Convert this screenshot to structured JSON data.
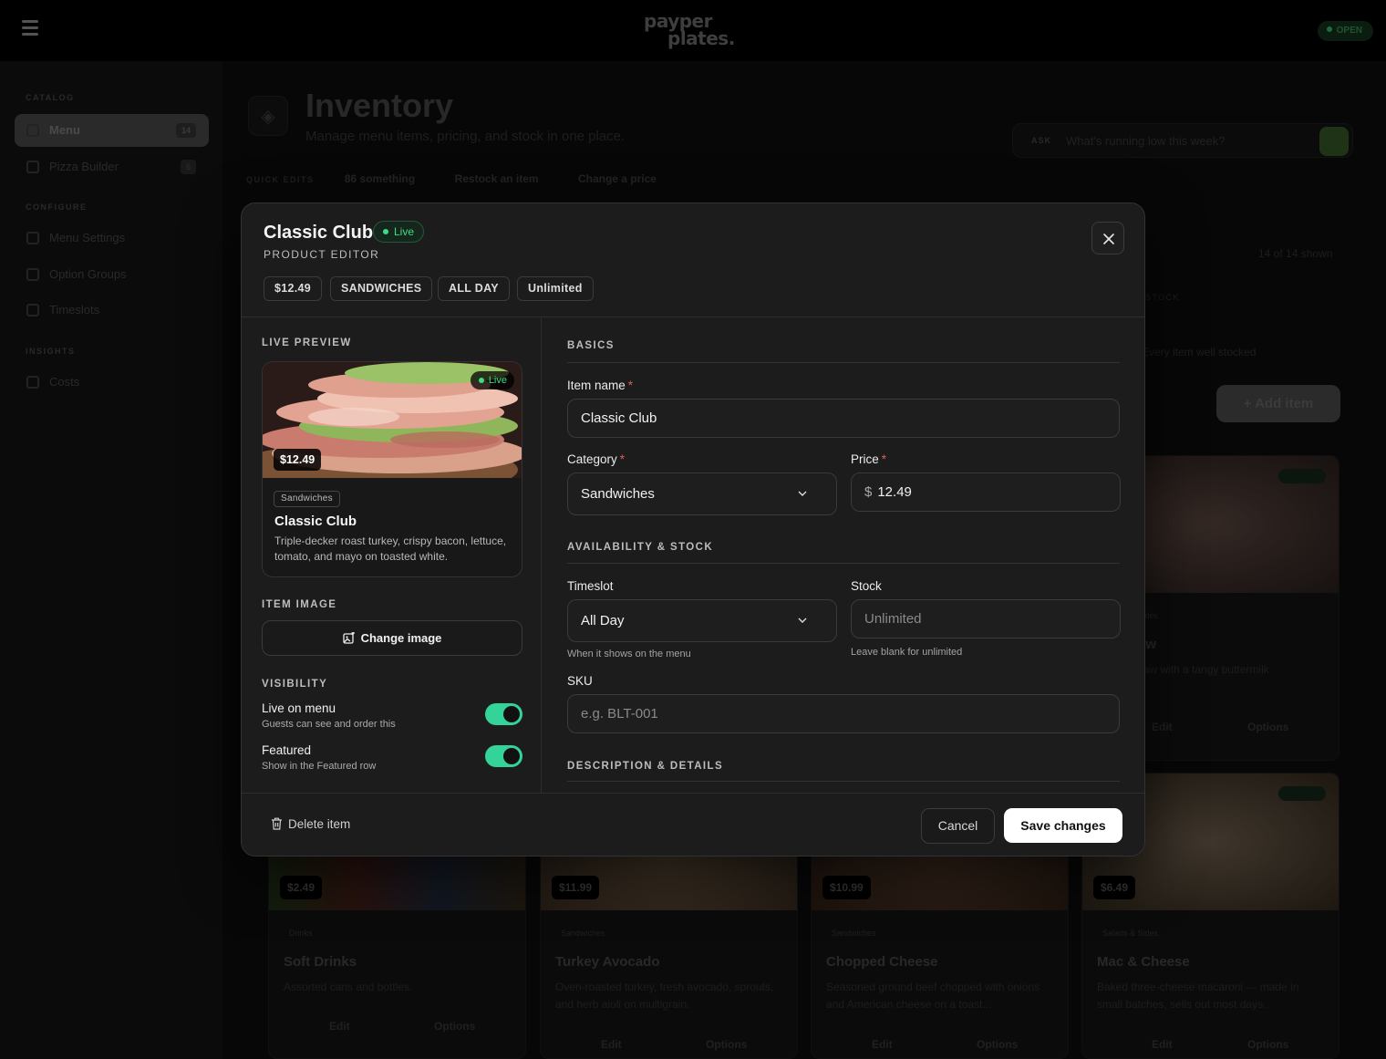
{
  "app": {
    "logo": [
      "payper",
      "plates."
    ],
    "status": "OPEN"
  },
  "sidebar": {
    "sections": [
      "CATALOG",
      "CONFIGURE",
      "INSIGHTS"
    ],
    "items": [
      {
        "label": "Menu",
        "count": "14",
        "active": true
      },
      {
        "label": "Pizza Builder",
        "count": "6"
      },
      {
        "label": "Menu Settings"
      },
      {
        "label": "Option Groups"
      },
      {
        "label": "Timeslots"
      },
      {
        "label": "Costs"
      }
    ]
  },
  "page": {
    "title": "Inventory",
    "subtitle": "Manage menu items, pricing, and stock in one place.",
    "ask_label": "ASK",
    "ask_placeholder": "What's running low this week?",
    "quick_edits_label": "QUICK EDITS",
    "quick_edits": [
      "86 something",
      "Restock an item",
      "Change a price"
    ],
    "shown_count": "14 of 14 shown",
    "stock_label": "STOCK",
    "stock_note": "Every item well stocked",
    "add_item_label": "+ Add item"
  },
  "cards": [
    {
      "price": "$2.49",
      "category": "Drinks",
      "name": "Soft Drinks",
      "desc": "Assorted cans and bottles.",
      "edit": "Edit",
      "options": "Options"
    },
    {
      "price": "$11.99",
      "category": "Sandwiches",
      "name": "Turkey Avocado",
      "desc": "Oven-roasted turkey, fresh avocado, sprouts, and herb aioli on multigrain.",
      "edit": "Edit",
      "options": "Options"
    },
    {
      "price": "$10.99",
      "category": "Sandwiches",
      "name": "Chopped Cheese",
      "desc": "Seasoned ground beef chopped with onions and American cheese on a toast...",
      "edit": "Edit",
      "options": "Options"
    },
    {
      "price": "$6.49",
      "category": "Salads & Sides",
      "name": "Mac & Cheese",
      "desc": "Baked three-cheese macaroni — made in small batches, sells out most days.",
      "edit": "Edit",
      "options": "Options"
    },
    {
      "category": "Salads & Sides",
      "name": "Coleslaw",
      "desc": "Classic slaw with a tangy buttermilk",
      "edit": "Edit",
      "options": "Options"
    }
  ],
  "modal": {
    "title": "Classic Club",
    "status_badge": "Live",
    "subtitle": "PRODUCT EDITOR",
    "chips": [
      "$12.49",
      "SANDWICHES",
      "ALL DAY",
      "Unlimited"
    ],
    "left": {
      "live_preview_label": "LIVE PREVIEW",
      "preview": {
        "badge": "Live",
        "price": "$12.49",
        "category": "Sandwiches",
        "name": "Classic Club",
        "description": "Triple-decker roast turkey, crispy bacon, lettuce, tomato, and mayo on toasted white."
      },
      "item_image_label": "ITEM IMAGE",
      "change_image_label": "Change image",
      "visibility_label": "VISIBILITY",
      "toggles": [
        {
          "title": "Live on menu",
          "desc": "Guests can see and order this",
          "on": true
        },
        {
          "title": "Featured",
          "desc": "Show in the Featured row",
          "on": true
        }
      ]
    },
    "right": {
      "basics_label": "BASICS",
      "item_name_label": "Item name",
      "item_name_value": "Classic Club",
      "category_label": "Category",
      "category_value": "Sandwiches",
      "price_label": "Price",
      "price_currency": "$",
      "price_value": "12.49",
      "availability_label": "AVAILABILITY & STOCK",
      "timeslot_label": "Timeslot",
      "timeslot_value": "All Day",
      "timeslot_hint": "When it shows on the menu",
      "stock_label": "Stock",
      "stock_placeholder": "Unlimited",
      "stock_hint": "Leave blank for unlimited",
      "sku_label": "SKU",
      "sku_placeholder": "e.g. BLT-001",
      "description_label": "DESCRIPTION & DETAILS",
      "required_mark": "*"
    },
    "footer": {
      "delete_label": "Delete item",
      "cancel_label": "Cancel",
      "save_label": "Save changes"
    }
  },
  "colors": {
    "accent_green": "#34d399",
    "live_green": "#3ddc84",
    "required_red": "#e05a5a",
    "modal_bg": "#1c1c1c"
  }
}
